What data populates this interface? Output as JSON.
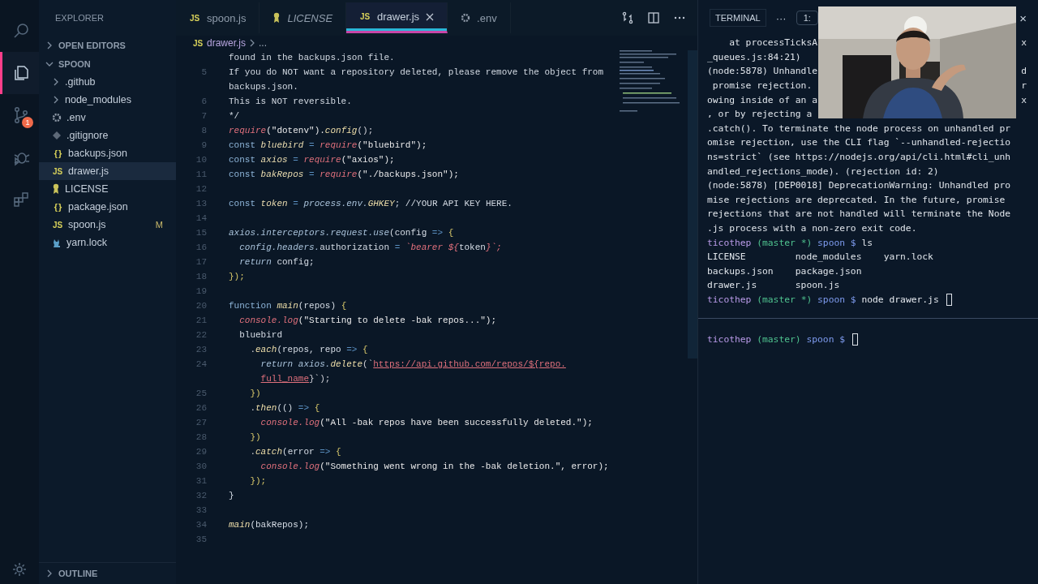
{
  "activity_bar": {
    "items": [
      {
        "kind": "search",
        "selected": false
      },
      {
        "kind": "explorer",
        "selected": true
      },
      {
        "kind": "source-control",
        "selected": false,
        "badge": "1"
      },
      {
        "kind": "debug",
        "selected": false
      },
      {
        "kind": "extensions",
        "selected": false
      }
    ]
  },
  "sidebar": {
    "title": "EXPLORER",
    "sections": [
      {
        "label": "OPEN EDITORS",
        "expanded": false
      },
      {
        "label": "SPOON",
        "expanded": true
      }
    ],
    "items": [
      {
        "label": ".github",
        "kind": "folder",
        "selected": false
      },
      {
        "label": "node_modules",
        "kind": "folder",
        "selected": false
      },
      {
        "label": ".env",
        "kind": "gear",
        "selected": false
      },
      {
        "label": ".gitignore",
        "kind": "git",
        "selected": false
      },
      {
        "label": "backups.json",
        "kind": "json",
        "icon": "{ }",
        "selected": false
      },
      {
        "label": "drawer.js",
        "kind": "js",
        "icon": "JS",
        "selected": true
      },
      {
        "label": "LICENSE",
        "kind": "license",
        "selected": false
      },
      {
        "label": "package.json",
        "kind": "json",
        "icon": "{ }",
        "selected": false
      },
      {
        "label": "spoon.js",
        "kind": "js",
        "icon": "JS",
        "selected": false,
        "badge": "M"
      },
      {
        "label": "yarn.lock",
        "kind": "yarn",
        "selected": false
      }
    ],
    "outline": "OUTLINE"
  },
  "tabs": [
    {
      "label": "spoon.js",
      "kind": "js",
      "icon": "JS",
      "selected": false,
      "preview": false
    },
    {
      "label": "LICENSE",
      "kind": "license",
      "selected": false,
      "preview": true
    },
    {
      "label": "drawer.js",
      "kind": "js",
      "icon": "JS",
      "selected": true,
      "preview": false
    },
    {
      "label": ".env",
      "kind": "gear",
      "selected": false,
      "preview": false
    }
  ],
  "breadcrumb": {
    "icon": "JS",
    "file": "drawer.js",
    "rest": "..."
  },
  "code": [
    {
      "tokens": [
        {
          "text": "found in the backups.json file.",
          "kind": "comment"
        }
      ]
    },
    {
      "number": "5",
      "tokens": [
        {
          "text": "If you do NOT want a repository deleted, please remove the object from",
          "kind": "comment"
        }
      ]
    },
    {
      "tokens": [
        {
          "text": "backups.json.",
          "kind": "comment"
        }
      ]
    },
    {
      "number": "6",
      "tokens": [
        {
          "text": "This is NOT reversible.",
          "kind": "comment"
        }
      ]
    },
    {
      "number": "7",
      "tokens": [
        {
          "text": "*/",
          "kind": "comment"
        }
      ]
    },
    {
      "number": "8",
      "tokens": [
        {
          "text": "require",
          "kind": "call"
        },
        {
          "text": "(\"dotenv\").",
          "kind": "str"
        },
        {
          "text": "config",
          "kind": "fn"
        },
        {
          "text": "();",
          "kind": "punct"
        }
      ]
    },
    {
      "number": "9",
      "tokens": [
        {
          "text": "const ",
          "kind": "kw"
        },
        {
          "text": "bluebird",
          "kind": "var"
        },
        {
          "text": " = ",
          "kind": "op"
        },
        {
          "text": "require",
          "kind": "call"
        },
        {
          "text": "(\"bluebird\");",
          "kind": "str"
        }
      ]
    },
    {
      "number": "10",
      "tokens": [
        {
          "text": "const ",
          "kind": "kw"
        },
        {
          "text": "axios",
          "kind": "var"
        },
        {
          "text": " = ",
          "kind": "op"
        },
        {
          "text": "require",
          "kind": "call"
        },
        {
          "text": "(\"axios\");",
          "kind": "str"
        }
      ]
    },
    {
      "number": "11",
      "tokens": [
        {
          "text": "const ",
          "kind": "kw"
        },
        {
          "text": "bakRepos",
          "kind": "var"
        },
        {
          "text": " = ",
          "kind": "op"
        },
        {
          "text": "require",
          "kind": "call"
        },
        {
          "text": "(\"./backups.json\");",
          "kind": "str"
        }
      ]
    },
    {
      "number": "12"
    },
    {
      "number": "13",
      "tokens": [
        {
          "text": "const ",
          "kind": "kw"
        },
        {
          "text": "token",
          "kind": "var"
        },
        {
          "text": " = ",
          "kind": "op"
        },
        {
          "text": "process.env.",
          "kind": "prop"
        },
        {
          "text": "GHKEY",
          "kind": "fn"
        },
        {
          "text": "; //YOUR API KEY HERE.",
          "kind": "comment"
        }
      ]
    },
    {
      "number": "14"
    },
    {
      "number": "15",
      "tokens": [
        {
          "text": "axios.interceptors.request.use",
          "kind": "prop"
        },
        {
          "text": "(config ",
          "kind": "plain"
        },
        {
          "text": "=>",
          "kind": "op"
        },
        {
          "text": " {",
          "kind": "brace"
        }
      ]
    },
    {
      "number": "16",
      "tokens": [
        {
          "text": "  config.headers.",
          "kind": "prop"
        },
        {
          "text": "authorization",
          "kind": "plain"
        },
        {
          "text": " = ",
          "kind": "op"
        },
        {
          "text": "`bearer ${",
          "kind": "call"
        },
        {
          "text": "token",
          "kind": "plain"
        },
        {
          "text": "}`;",
          "kind": "call"
        }
      ]
    },
    {
      "number": "17",
      "tokens": [
        {
          "text": "  return ",
          "kind": "prop"
        },
        {
          "text": "config;",
          "kind": "plain"
        }
      ]
    },
    {
      "number": "18",
      "tokens": [
        {
          "text": "});",
          "kind": "brace"
        }
      ]
    },
    {
      "number": "19"
    },
    {
      "number": "20",
      "tokens": [
        {
          "text": "function ",
          "kind": "kw"
        },
        {
          "text": "main",
          "kind": "fn"
        },
        {
          "text": "(repos) ",
          "kind": "plain"
        },
        {
          "text": "{",
          "kind": "brace"
        }
      ]
    },
    {
      "number": "21",
      "tokens": [
        {
          "text": "  console.log",
          "kind": "call"
        },
        {
          "text": "(\"Starting to delete -bak repos...\");",
          "kind": "str"
        }
      ]
    },
    {
      "number": "22",
      "tokens": [
        {
          "text": "  bluebird",
          "kind": "plain"
        }
      ]
    },
    {
      "number": "23",
      "tokens": [
        {
          "text": "    .",
          "kind": "punct"
        },
        {
          "text": "each",
          "kind": "fn"
        },
        {
          "text": "(repos, repo ",
          "kind": "plain"
        },
        {
          "text": "=>",
          "kind": "op"
        },
        {
          "text": " {",
          "kind": "brace"
        }
      ]
    },
    {
      "number": "24",
      "tokens": [
        {
          "text": "      return axios.",
          "kind": "prop"
        },
        {
          "text": "delete",
          "kind": "fn"
        },
        {
          "text": "(`",
          "kind": "punct"
        },
        {
          "text": "https://api.github.com/repos/${repo.",
          "kind": "url"
        }
      ]
    },
    {
      "tokens": [
        {
          "text": "full_name",
          "kind": "url"
        },
        {
          "text": "}`);",
          "kind": "punct"
        }
      ]
    },
    {
      "number": "25",
      "tokens": [
        {
          "text": "    })",
          "kind": "brace"
        }
      ]
    },
    {
      "number": "26",
      "tokens": [
        {
          "text": "    .",
          "kind": "punct"
        },
        {
          "text": "then",
          "kind": "fn"
        },
        {
          "text": "(() ",
          "kind": "plain"
        },
        {
          "text": "=>",
          "kind": "op"
        },
        {
          "text": " {",
          "kind": "brace"
        }
      ]
    },
    {
      "number": "27",
      "tokens": [
        {
          "text": "      console.log",
          "kind": "call"
        },
        {
          "text": "(\"All -bak repos have been successfully deleted.\");",
          "kind": "str"
        }
      ]
    },
    {
      "number": "28",
      "tokens": [
        {
          "text": "    })",
          "kind": "brace"
        }
      ]
    },
    {
      "number": "29",
      "tokens": [
        {
          "text": "    .",
          "kind": "punct"
        },
        {
          "text": "catch",
          "kind": "fn"
        },
        {
          "text": "(error ",
          "kind": "plain"
        },
        {
          "text": "=>",
          "kind": "op"
        },
        {
          "text": " {",
          "kind": "brace"
        }
      ]
    },
    {
      "number": "30",
      "tokens": [
        {
          "text": "      console.log",
          "kind": "call"
        },
        {
          "text": "(\"Something went wrong in the -bak deletion.\", error);",
          "kind": "str"
        }
      ]
    },
    {
      "number": "31",
      "tokens": [
        {
          "text": "    });",
          "kind": "brace"
        }
      ]
    },
    {
      "number": "32",
      "tokens": [
        {
          "text": "}",
          "kind": "plain"
        }
      ]
    },
    {
      "number": "33"
    },
    {
      "number": "34",
      "tokens": [
        {
          "text": "main",
          "kind": "fn"
        },
        {
          "text": "(bakRepos);",
          "kind": "plain"
        }
      ]
    },
    {
      "number": "35"
    }
  ],
  "terminal": {
    "title": "TERMINAL",
    "more": "···",
    "selector": "1:",
    "close": "×",
    "upper": [
      {
        "text": "    at processTicksA",
        "tail": "x"
      },
      {
        "text": "_queues.js:84:21)"
      },
      {
        "text": "(node:5878) Unhandle",
        "tail": "d"
      },
      {
        "text": " promise rejection.",
        "tail": "r"
      },
      {
        "text": "owing inside of an a",
        "tail": "x"
      },
      {
        "text": ", or by rejecting a"
      },
      {
        "text": ".catch(). To terminate the node process on unhandled pr"
      },
      {
        "text": "omise rejection, use the CLI flag `--unhandled-rejectio"
      },
      {
        "text": "ns=strict` (see https://nodejs.org/api/cli.html#cli_unh"
      },
      {
        "text": "andled_rejections_mode). (rejection id: 2)"
      },
      {
        "text": "(node:5878) [DEP0018] DeprecationWarning: Unhandled pro"
      },
      {
        "text": "mise rejections are deprecated. In the future, promise"
      },
      {
        "text": "rejections that are not handled will terminate the Node"
      },
      {
        "text": ".js process with a non-zero exit code."
      },
      {
        "tokens": [
          {
            "text": "ticothep ",
            "kind": "user"
          },
          {
            "text": "(master *) ",
            "kind": "branch"
          },
          {
            "text": "spoon $ ",
            "kind": "dir"
          },
          {
            "text": "ls",
            "kind": "cmd"
          }
        ]
      },
      {
        "text": "LICENSE         node_modules    yarn.lock"
      },
      {
        "text": "backups.json    package.json"
      },
      {
        "text": "drawer.js       spoon.js"
      },
      {
        "tokens": [
          {
            "text": "ticothep ",
            "kind": "user"
          },
          {
            "text": "(master *) ",
            "kind": "branch"
          },
          {
            "text": "spoon $ ",
            "kind": "dir"
          },
          {
            "text": "node drawer.js ",
            "kind": "cmd"
          }
        ],
        "cursor": true
      }
    ],
    "lower": [
      {
        "tokens": [
          {
            "text": "ticothep ",
            "kind": "user"
          },
          {
            "text": "(master) ",
            "kind": "branch"
          },
          {
            "text": "spoon $ ",
            "kind": "dir"
          }
        ],
        "cursor": true
      }
    ]
  }
}
